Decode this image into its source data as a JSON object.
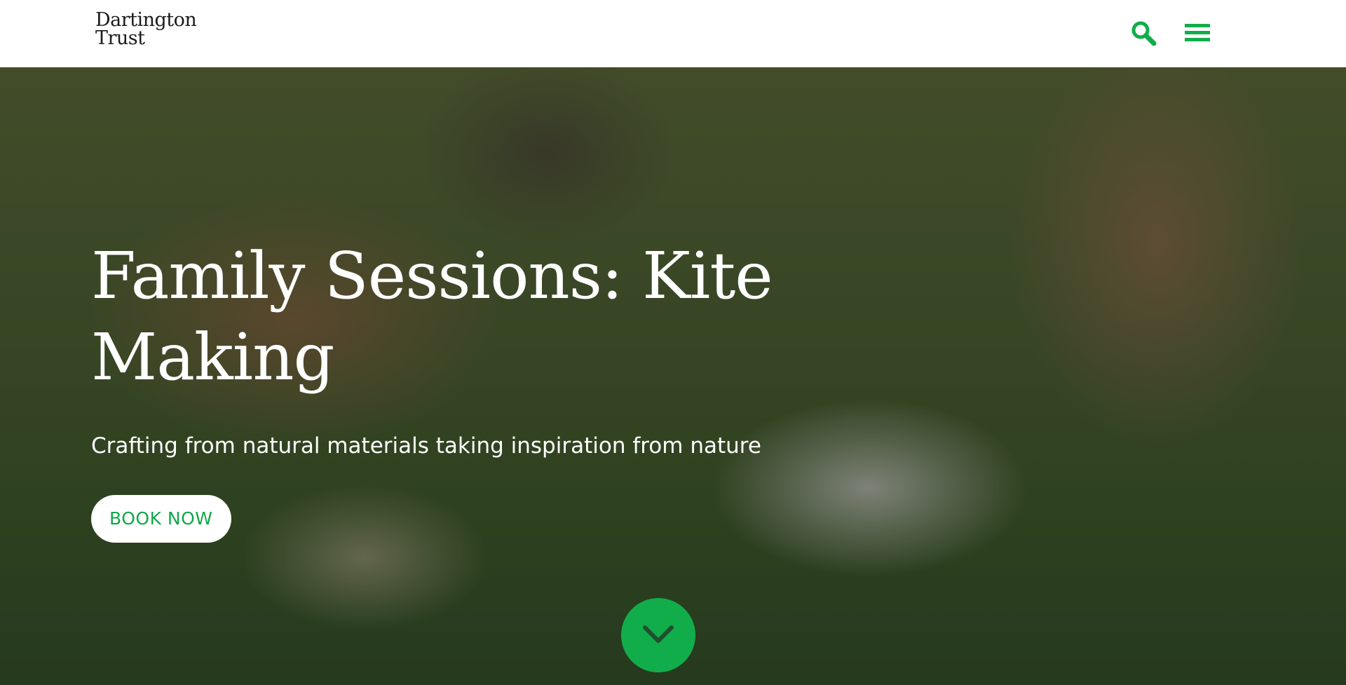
{
  "header": {
    "logo_line1": "Dartington",
    "logo_line2": "Trust",
    "search_icon": "search-icon",
    "menu_icon": "hamburger-menu-icon"
  },
  "hero": {
    "title": "Family Sessions: Kite Making",
    "subtitle": "Crafting from natural materials taking inspiration from nature",
    "cta_label": "BOOK NOW",
    "scroll_icon": "chevron-down-icon"
  },
  "colors": {
    "accent": "#12ad4b",
    "header_bg": "#ffffff",
    "text_on_hero": "#ffffff"
  }
}
